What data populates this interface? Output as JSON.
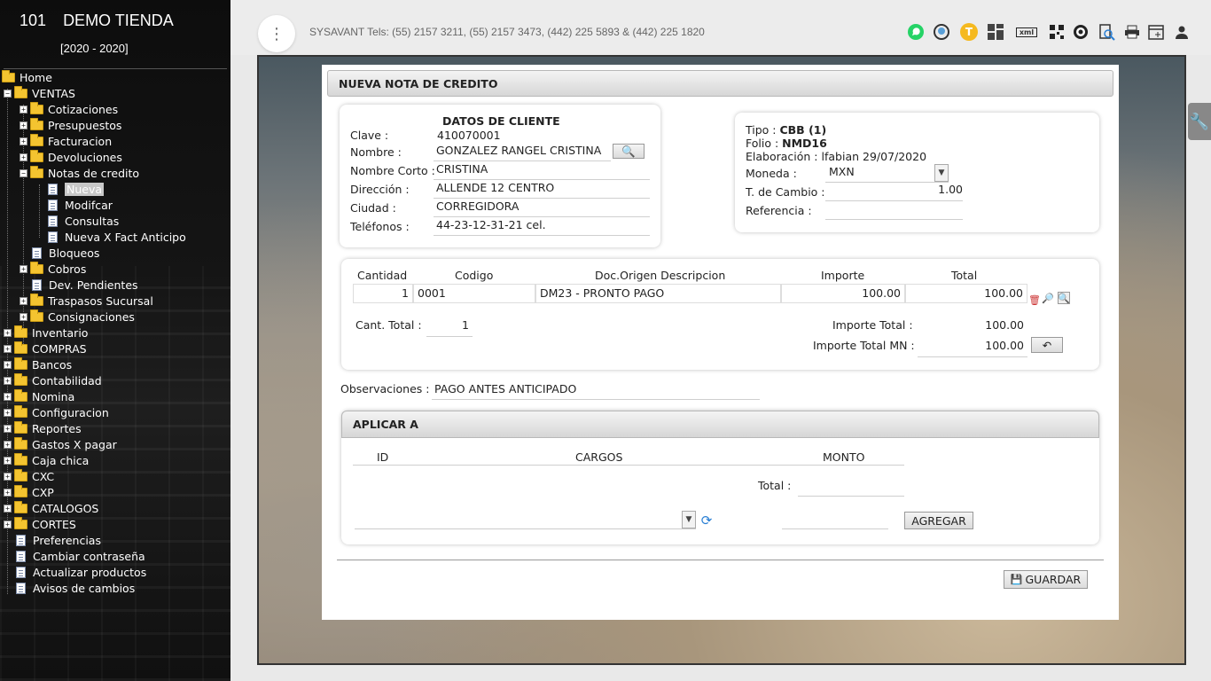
{
  "sidebar": {
    "store_number": "101",
    "store_name": "DEMO TIENDA",
    "years": "[2020 - 2020]",
    "tree": {
      "home": "Home",
      "ventas": "VENTAS",
      "cotizaciones": "Cotizaciones",
      "presupuestos": "Presupuestos",
      "facturacion": "Facturacion",
      "devoluciones": "Devoluciones",
      "notas_credito": "Notas de credito",
      "nueva": "Nueva",
      "modifcar": "Modifcar",
      "consultas": "Consultas",
      "nueva_x_fact": "Nueva X Fact Anticipo",
      "bloqueos": "Bloqueos",
      "cobros": "Cobros",
      "dev_pendientes": "Dev. Pendientes",
      "traspasos": "Traspasos Sucursal",
      "consignaciones": "Consignaciones",
      "inventario": "Inventario",
      "compras": "COMPRAS",
      "bancos": "Bancos",
      "contabilidad": "Contabilidad",
      "nomina": "Nomina",
      "configuracion": "Configuracion",
      "reportes": "Reportes",
      "gastos": "Gastos X pagar",
      "caja_chica": "Caja chica",
      "cxc": "CXC",
      "cxp": "CXP",
      "catalogos": "CATALOGOS",
      "cortes": "CORTES",
      "preferencias": "Preferencias",
      "cambiar_pass": "Cambiar contraseña",
      "actualizar": "Actualizar productos",
      "avisos": "Avisos de cambios"
    }
  },
  "topbar": {
    "tels": "SYSAVANT Tels: (55) 2157 3211, (55) 2157 3473, (442) 225 5893 & (442) 225 1820",
    "icons": [
      "whatsapp-icon",
      "support-icon",
      "user-t-icon",
      "grid-icon",
      "xml-icon",
      "qr-icon",
      "target-icon",
      "search-doc-icon",
      "printer-icon",
      "new-window-icon",
      "profile-icon"
    ],
    "user_initial": "T",
    "xml_label": "xml"
  },
  "form": {
    "title": "NUEVA NOTA DE CREDITO",
    "cliente": {
      "header": "DATOS DE CLIENTE",
      "clave_label": "Clave :",
      "clave": "410070001",
      "nombre_label": "Nombre :",
      "nombre": "GONZALEZ RANGEL CRISTINA",
      "nombre_corto_label": "Nombre Corto :",
      "nombre_corto": "CRISTINA",
      "direccion_label": "Dirección :",
      "direccion": "ALLENDE 12 CENTRO",
      "ciudad_label": "Ciudad :",
      "ciudad": "CORREGIDORA",
      "telefonos_label": "Teléfonos :",
      "telefonos": "44-23-12-31-21 cel."
    },
    "doc": {
      "tipo_label": "Tipo :",
      "tipo": "CBB (1)",
      "folio_label": "Folio :",
      "folio": "NMD16",
      "elaboracion_label": "Elaboración :",
      "elaboracion": "lfabian 29/07/2020",
      "moneda_label": "Moneda :",
      "moneda": "MXN",
      "tcambio_label": "T. de Cambio :",
      "tcambio": "1.00",
      "referencia_label": "Referencia :",
      "referencia": ""
    },
    "items": {
      "headers": [
        "Cantidad",
        "Codigo",
        "Doc.Origen Descripcion",
        "Importe",
        "Total"
      ],
      "rows": [
        {
          "cantidad": "1",
          "codigo": "0001",
          "descripcion": "DM23 - PRONTO PAGO",
          "importe": "100.00",
          "total": "100.00"
        }
      ],
      "cant_total_label": "Cant. Total :",
      "cant_total": "1",
      "importe_total_label": "Importe Total :",
      "importe_total": "100.00",
      "importe_total_mn_label": "Importe Total MN :",
      "importe_total_mn": "100.00"
    },
    "observaciones_label": "Observaciones :",
    "observaciones": "PAGO ANTES ANTICIPADO",
    "aplicar": {
      "title": "APLICAR A",
      "headers": [
        "ID",
        "CARGOS",
        "MONTO"
      ],
      "total_label": "Total :",
      "total": "",
      "agregar_label": "AGREGAR"
    },
    "guardar_label": "GUARDAR"
  },
  "colors": {
    "accent": "#f4c430",
    "whatsapp": "#25d366"
  }
}
